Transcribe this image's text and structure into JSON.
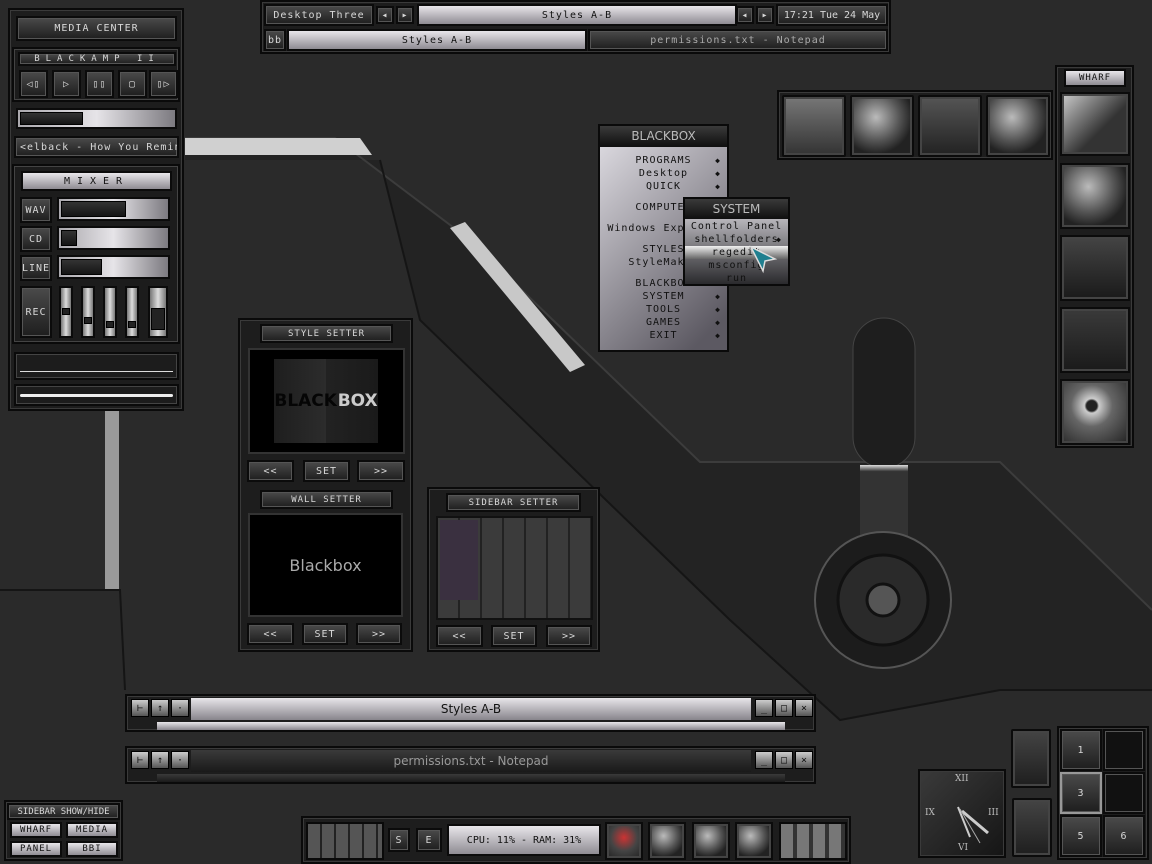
{
  "media_center": {
    "title": "MEDIA CENTER",
    "player": "BLACKAMP II",
    "controls": [
      "prev",
      "play",
      "pause",
      "stop",
      "next"
    ],
    "control_glyphs": [
      "◁▯",
      "▷",
      "▯▯",
      "▢",
      "▯▷"
    ],
    "progress": 0.4,
    "track": "<elback - How You Remind",
    "mixer": {
      "title": "MIXER",
      "channels": [
        {
          "label": "WAV",
          "level": 0.6
        },
        {
          "label": "CD",
          "level": 0.15
        },
        {
          "label": "LINE",
          "level": 0.38
        }
      ],
      "rec_label": "REC",
      "rec_levels": [
        0.55,
        0.3,
        0.2,
        0.2,
        0.15
      ]
    }
  },
  "toolbar": {
    "workspace": "Desktop Three",
    "current": "Styles A-B",
    "clock": "17:21 Tue 24 May",
    "bb": "bb",
    "tasks": [
      "Styles A-B",
      "permissions.txt - Notepad"
    ]
  },
  "menu": {
    "title": "BLACKBOX",
    "items": [
      {
        "label": "PROGRAMS",
        "sub": true
      },
      {
        "label": "Desktop",
        "sub": true
      },
      {
        "label": "QUICK",
        "sub": true
      },
      {
        "label": "",
        "sub": false
      },
      {
        "label": "COMPUTER",
        "sub": false
      },
      {
        "label": "",
        "sub": false
      },
      {
        "label": "Windows Explorer",
        "sub": false
      },
      {
        "label": "",
        "sub": false
      },
      {
        "label": "STYLES",
        "sub": false
      },
      {
        "label": "StyleMaker",
        "sub": false
      },
      {
        "label": "",
        "sub": false
      },
      {
        "label": "BLACKBOX",
        "sub": false
      },
      {
        "label": "SYSTEM",
        "sub": true
      },
      {
        "label": "TOOLS",
        "sub": true
      },
      {
        "label": "GAMES",
        "sub": true
      },
      {
        "label": "EXIT",
        "sub": true
      }
    ],
    "submenu": {
      "title": "SYSTEM",
      "items": [
        {
          "label": "Control Panel",
          "sub": false
        },
        {
          "label": "shellfolders",
          "sub": true
        },
        {
          "label": "regedit",
          "sub": false
        },
        {
          "label": "msconfig",
          "sub": false
        },
        {
          "label": "run",
          "sub": false
        }
      ],
      "highlighted": "regedit"
    }
  },
  "style_setter": {
    "title": "STYLE SETTER",
    "preview": [
      "BLACK",
      "BOX"
    ],
    "prev": "<<",
    "set": "SET",
    "next": ">>"
  },
  "wall_setter": {
    "title": "WALL SETTER",
    "preview": "Blackbox",
    "prev": "<<",
    "set": "SET",
    "next": ">>"
  },
  "sidebar_setter": {
    "title": "SIDEBAR SETTER",
    "prev": "<<",
    "set": "SET",
    "next": ">>"
  },
  "wharf": {
    "title": "WHARF",
    "icons": [
      "monitor-icon",
      "globe-icon",
      "design-tools-icon",
      "notepad-pencil-icon",
      "disc-drive-icon"
    ]
  },
  "launcher": {
    "icons": [
      "document-pencil-icon",
      "gears-icon",
      "video-camera-icon",
      "cd-icon"
    ]
  },
  "windows": [
    {
      "title": "Styles A-B",
      "active": true
    },
    {
      "title": "permissions.txt - Notepad",
      "active": false
    }
  ],
  "sidebar_toggle": {
    "title": "SIDEBAR SHOW/HIDE",
    "buttons": [
      "WHARF",
      "MEDIA",
      "PANEL",
      "BBI"
    ]
  },
  "bottom_bar": {
    "s": "S",
    "e": "E",
    "stats": "CPU: 11% - RAM: 31%"
  },
  "clock": {
    "numerals": [
      "XII",
      "III",
      "VI",
      "IX"
    ],
    "time": "17:21"
  },
  "pager": {
    "desktops": [
      "1",
      "",
      "3",
      "",
      "5",
      "6"
    ],
    "active": "3"
  }
}
